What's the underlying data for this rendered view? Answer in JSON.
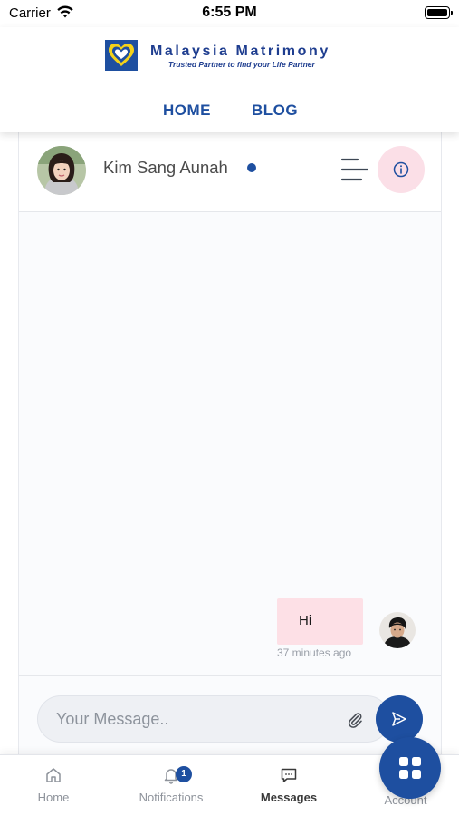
{
  "status_bar": {
    "carrier": "Carrier",
    "time": "6:55 PM"
  },
  "header": {
    "brand_name": "Malaysia Matrimony",
    "tagline": "Trusted Partner to find your Life Partner",
    "nav": [
      {
        "label": "HOME"
      },
      {
        "label": "BLOG"
      }
    ]
  },
  "chat": {
    "contact_name": "Kim Sang Aunah",
    "contact_online": true,
    "messages": [
      {
        "text": "Hi",
        "time": "37 minutes ago",
        "from": "me"
      }
    ],
    "composer": {
      "placeholder": "Your Message.."
    }
  },
  "bottom_nav": {
    "items": [
      {
        "label": "Home",
        "icon": "home-icon"
      },
      {
        "label": "Notifications",
        "icon": "bell-icon",
        "badge": "1"
      },
      {
        "label": "Messages",
        "icon": "chat-icon",
        "active": true
      },
      {
        "label": "Account",
        "icon": "grid-icon"
      }
    ]
  },
  "colors": {
    "primary": "#1e4fa0",
    "pink": "#fde0e6",
    "muted": "#8e939b"
  }
}
